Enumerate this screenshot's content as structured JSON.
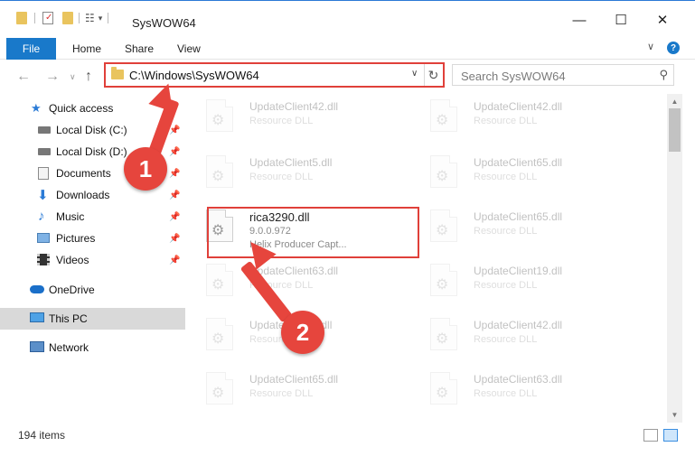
{
  "window": {
    "title": "SysWOW64",
    "minimize_glyph": "—",
    "maximize_glyph": "☐",
    "close_glyph": "✕"
  },
  "ribbon": {
    "file_tab": "File",
    "tabs": [
      "Home",
      "Share",
      "View"
    ],
    "help": "?"
  },
  "address_bar": {
    "path": "C:\\Windows\\SysWOW64"
  },
  "search": {
    "placeholder": "Search SysWOW64"
  },
  "sidebar": {
    "items": [
      {
        "label": "Quick access",
        "icon": "star-icon"
      },
      {
        "label": "Local Disk (C:)",
        "icon": "drive-icon",
        "pinned": true
      },
      {
        "label": "Local Disk (D:)",
        "icon": "drive-icon",
        "pinned": true
      },
      {
        "label": "Documents",
        "icon": "documents-icon",
        "pinned": true
      },
      {
        "label": "Downloads",
        "icon": "downloads-icon",
        "pinned": true
      },
      {
        "label": "Music",
        "icon": "music-icon",
        "pinned": true
      },
      {
        "label": "Pictures",
        "icon": "pictures-icon",
        "pinned": true
      },
      {
        "label": "Videos",
        "icon": "videos-icon",
        "pinned": true
      },
      {
        "label": "OneDrive",
        "icon": "cloud-icon"
      },
      {
        "label": "This PC",
        "icon": "computer-icon",
        "selected": true
      },
      {
        "label": "Network",
        "icon": "network-icon"
      }
    ]
  },
  "files": {
    "left": [
      {
        "name": "UpdateClient42.dll",
        "type": "Resource DLL"
      },
      {
        "name": "UpdateClient5.dll",
        "type": "Resource DLL"
      },
      {
        "name": "rica3290.dll",
        "version": "9.0.0.972",
        "description": "Helix Producer Capt..."
      },
      {
        "name": "UpdateClient63.dll",
        "type": "Resource DLL"
      },
      {
        "name": "UpdateClient5.dll",
        "type": "Resource DLL"
      },
      {
        "name": "UpdateClient65.dll",
        "type": "Resource DLL"
      }
    ],
    "right": [
      {
        "name": "UpdateClient42.dll",
        "type": "Resource DLL"
      },
      {
        "name": "UpdateClient65.dll",
        "type": "Resource DLL"
      },
      {
        "name": "UpdateClient65.dll",
        "type": "Resource DLL"
      },
      {
        "name": "UpdateClient19.dll",
        "type": "Resource DLL"
      },
      {
        "name": "UpdateClient42.dll",
        "type": "Resource DLL"
      },
      {
        "name": "UpdateClient63.dll",
        "type": "Resource DLL"
      }
    ]
  },
  "status": {
    "count": "194 items"
  },
  "annotations": {
    "step1": "1",
    "step2": "2",
    "color": "#e6453d"
  }
}
